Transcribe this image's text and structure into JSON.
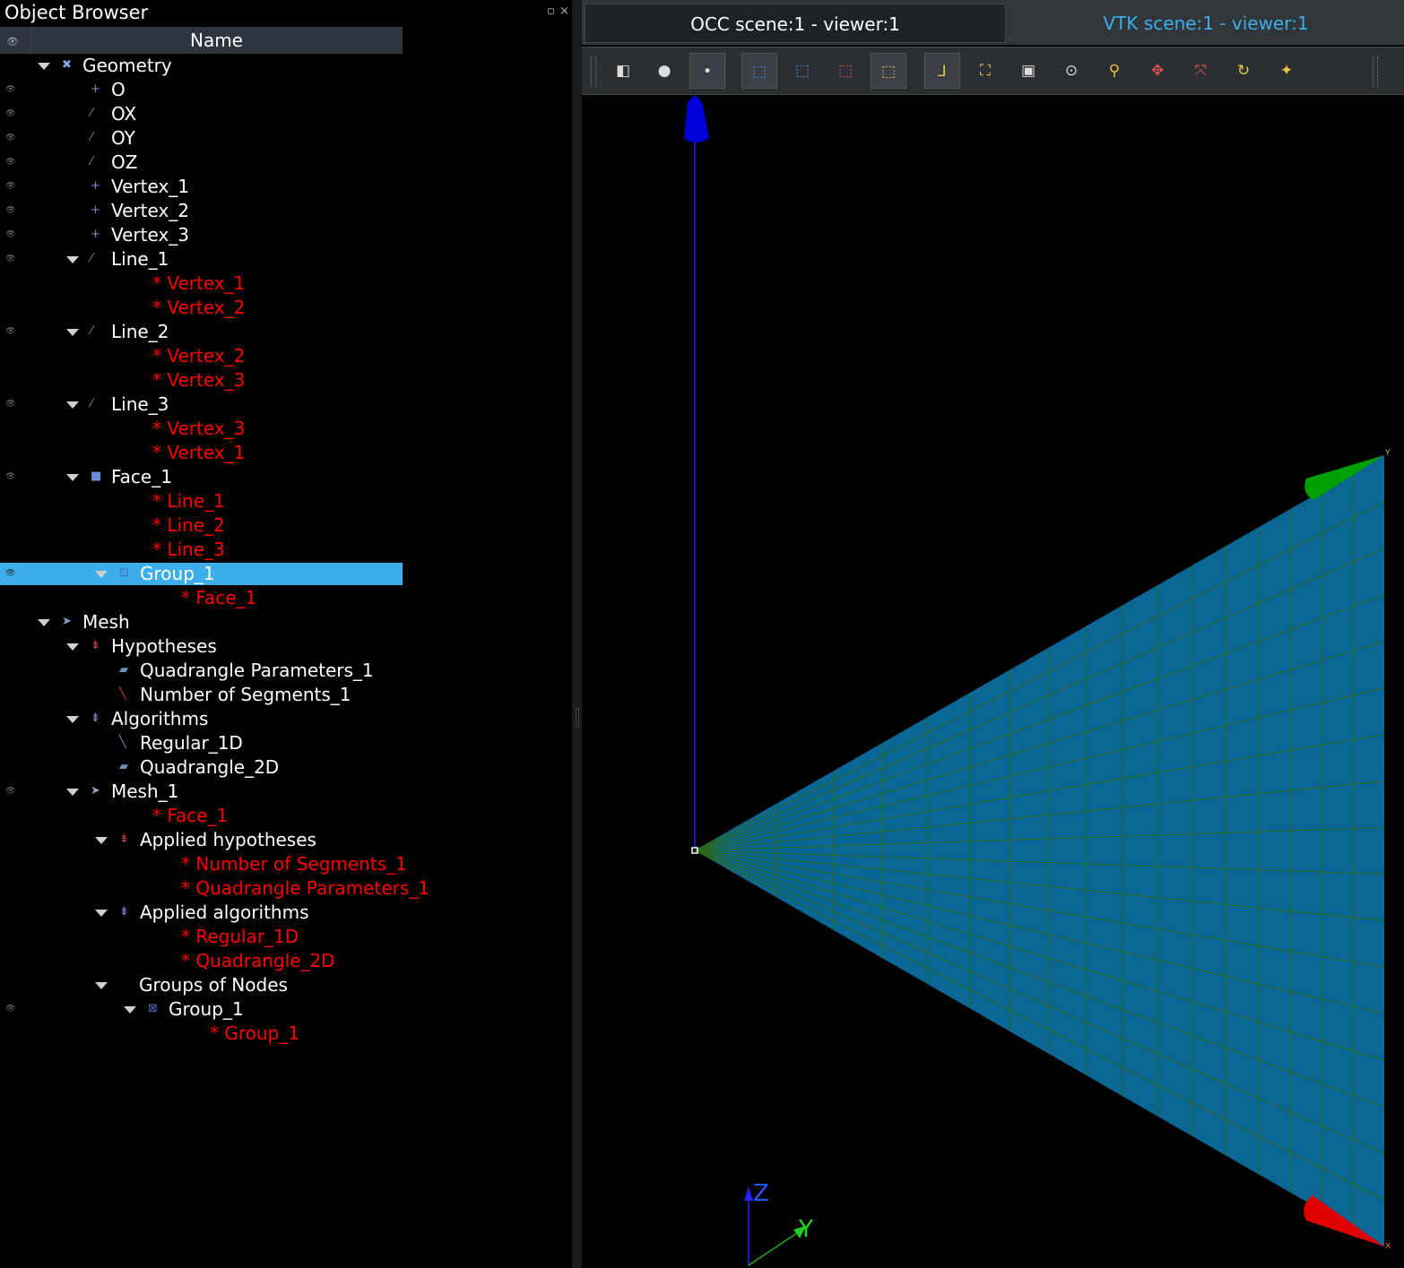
{
  "browser": {
    "title": "Object Browser",
    "float_icon": "▫",
    "close_icon": "×",
    "header": {
      "visibility_col": "👁",
      "name_col": "Name"
    },
    "rows": [
      {
        "label": "Geometry",
        "indent": 0,
        "expanded": true,
        "ref": false,
        "eye": false,
        "icon": "✖",
        "icon_color": "#7fa8e0"
      },
      {
        "label": "O",
        "indent": 1,
        "ref": false,
        "eye": true,
        "icon": "+",
        "icon_color": "#6a8fc8"
      },
      {
        "label": "OX",
        "indent": 1,
        "ref": false,
        "eye": true,
        "icon": "⁄",
        "icon_color": "#888"
      },
      {
        "label": "OY",
        "indent": 1,
        "ref": false,
        "eye": true,
        "icon": "⁄",
        "icon_color": "#888"
      },
      {
        "label": "OZ",
        "indent": 1,
        "ref": false,
        "eye": true,
        "icon": "⁄",
        "icon_color": "#888"
      },
      {
        "label": "Vertex_1",
        "indent": 1,
        "ref": false,
        "eye": true,
        "icon": "+",
        "icon_color": "#6a8fc8"
      },
      {
        "label": "Vertex_2",
        "indent": 1,
        "ref": false,
        "eye": true,
        "icon": "+",
        "icon_color": "#6a8fc8"
      },
      {
        "label": "Vertex_3",
        "indent": 1,
        "ref": false,
        "eye": true,
        "icon": "+",
        "icon_color": "#6a8fc8"
      },
      {
        "label": "Line_1",
        "indent": 1,
        "expanded": true,
        "ref": false,
        "eye": true,
        "icon": "⁄",
        "icon_color": "#888"
      },
      {
        "label": "* Vertex_1",
        "indent": 2,
        "ref": true
      },
      {
        "label": "* Vertex_2",
        "indent": 2,
        "ref": true
      },
      {
        "label": "Line_2",
        "indent": 1,
        "expanded": true,
        "ref": false,
        "eye": true,
        "icon": "⁄",
        "icon_color": "#888"
      },
      {
        "label": "* Vertex_2",
        "indent": 2,
        "ref": true
      },
      {
        "label": "* Vertex_3",
        "indent": 2,
        "ref": true
      },
      {
        "label": "Line_3",
        "indent": 1,
        "expanded": true,
        "ref": false,
        "eye": true,
        "icon": "⁄",
        "icon_color": "#888"
      },
      {
        "label": "* Vertex_3",
        "indent": 2,
        "ref": true
      },
      {
        "label": "* Vertex_1",
        "indent": 2,
        "ref": true
      },
      {
        "label": "Face_1",
        "indent": 1,
        "expanded": true,
        "ref": false,
        "eye": true,
        "icon": "■",
        "icon_color": "#6a8fd8"
      },
      {
        "label": "* Line_1",
        "indent": 2,
        "ref": true
      },
      {
        "label": "* Line_2",
        "indent": 2,
        "ref": true
      },
      {
        "label": "* Line_3",
        "indent": 2,
        "ref": true
      },
      {
        "label": "Group_1",
        "indent": 2,
        "expanded": true,
        "ref": false,
        "eye": true,
        "selected": true,
        "icon": "⊡",
        "icon_color": "#3a6aa8"
      },
      {
        "label": "* Face_1",
        "indent": 3,
        "ref": true
      },
      {
        "label": "Mesh",
        "indent": 0,
        "expanded": true,
        "ref": false,
        "eye": false,
        "icon": "➤",
        "icon_color": "#8aa0c8"
      },
      {
        "label": "Hypotheses",
        "indent": 1,
        "expanded": true,
        "ref": false,
        "eye": false,
        "icon": "⇟",
        "icon_color": "#d04040"
      },
      {
        "label": "Quadrangle Parameters_1",
        "indent": 2,
        "ref": false,
        "icon": "▰",
        "icon_color": "#7090c0"
      },
      {
        "label": "Number of Segments_1",
        "indent": 2,
        "ref": false,
        "icon": "╲",
        "icon_color": "#d04040"
      },
      {
        "label": "Algorithms",
        "indent": 1,
        "expanded": true,
        "ref": false,
        "eye": false,
        "icon": "⇟",
        "icon_color": "#7090d0"
      },
      {
        "label": "Regular_1D",
        "indent": 2,
        "ref": false,
        "icon": "╲",
        "icon_color": "#7090c0"
      },
      {
        "label": "Quadrangle_2D",
        "indent": 2,
        "ref": false,
        "icon": "▰",
        "icon_color": "#7090c0"
      },
      {
        "label": "Mesh_1",
        "indent": 1,
        "expanded": true,
        "ref": false,
        "eye": true,
        "icon": "➤",
        "icon_color": "#8aa0c8"
      },
      {
        "label": "* Face_1",
        "indent": 2,
        "ref": true
      },
      {
        "label": "Applied hypotheses",
        "indent": 2,
        "expanded": true,
        "ref": false,
        "icon": "⇟",
        "icon_color": "#d04040"
      },
      {
        "label": "* Number of Segments_1",
        "indent": 3,
        "ref": true
      },
      {
        "label": "* Quadrangle Parameters_1",
        "indent": 3,
        "ref": true
      },
      {
        "label": "Applied algorithms",
        "indent": 2,
        "expanded": true,
        "ref": false,
        "icon": "⇟",
        "icon_color": "#7090d0"
      },
      {
        "label": "* Regular_1D",
        "indent": 3,
        "ref": true
      },
      {
        "label": "* Quadrangle_2D",
        "indent": 3,
        "ref": true
      },
      {
        "label": "Groups of Nodes",
        "indent": 2,
        "expanded": true,
        "ref": false,
        "noicon": true
      },
      {
        "label": "Group_1",
        "indent": 3,
        "expanded": true,
        "ref": false,
        "eye": true,
        "icon": "⊠",
        "icon_color": "#5070c0"
      },
      {
        "label": "* Group_1",
        "indent": 4,
        "ref": true
      }
    ]
  },
  "viewer": {
    "tabs": [
      {
        "label": "OCC scene:1 - viewer:1",
        "active": true
      },
      {
        "label": "VTK scene:1 - viewer:1",
        "active": false
      }
    ],
    "toolbar": [
      {
        "name": "dump-view-icon",
        "glyph": "◧",
        "style": ""
      },
      {
        "name": "background-icon",
        "glyph": "●",
        "style": ""
      },
      {
        "name": "selection-point-icon",
        "glyph": "•",
        "style": "on"
      },
      {
        "name": "select-icon",
        "glyph": "⬚",
        "style": "on blue"
      },
      {
        "name": "select-multi-icon",
        "glyph": "⬚",
        "style": "blue"
      },
      {
        "name": "select-rect-icon",
        "glyph": "⬚",
        "style": "red"
      },
      {
        "name": "select-poly-icon",
        "glyph": "⬚",
        "style": "on yellow"
      },
      {
        "name": "show-trihedron-icon",
        "glyph": "⅃",
        "style": "on yellow"
      },
      {
        "name": "fit-all-icon",
        "glyph": "⛶",
        "style": "yellow"
      },
      {
        "name": "fit-area-icon",
        "glyph": "▣",
        "style": ""
      },
      {
        "name": "fit-selection-icon",
        "glyph": "⊙",
        "style": ""
      },
      {
        "name": "zoom-icon",
        "glyph": "⚲",
        "style": "yellow"
      },
      {
        "name": "pan-icon",
        "glyph": "✥",
        "style": "red"
      },
      {
        "name": "global-pan-icon",
        "glyph": "⤧",
        "style": "red"
      },
      {
        "name": "rotate-icon",
        "glyph": "↻",
        "style": "yellow"
      },
      {
        "name": "rotation-point-icon",
        "glyph": "✦",
        "style": "yellow"
      }
    ],
    "trihedron": {
      "x_label": "X",
      "y_label": "Y",
      "z_label": "Z"
    },
    "colors": {
      "face": "#0a6694",
      "mesh_lines": "#2a6a1a",
      "x_axis": "#e00000",
      "y_axis": "#00b000",
      "z_axis": "#0000e0"
    }
  }
}
